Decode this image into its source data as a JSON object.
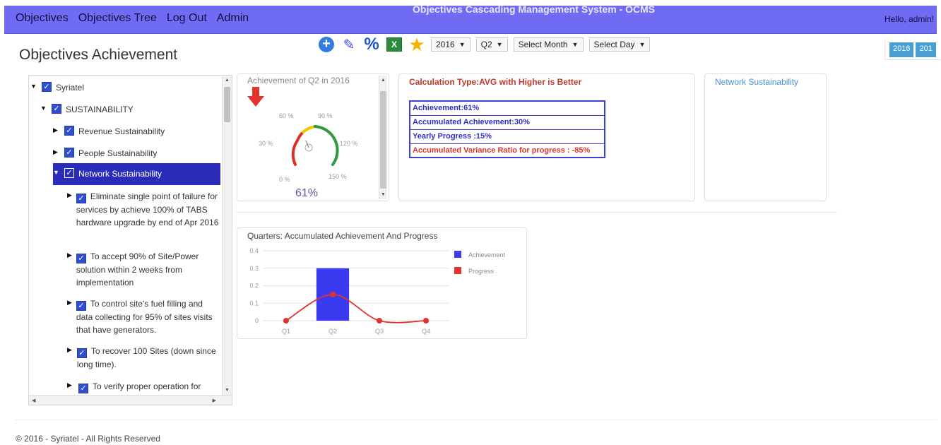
{
  "nav": {
    "links": [
      "Objectives",
      "Objectives Tree",
      "Log Out",
      "Admin"
    ],
    "system_title": "Objectives Cascading Management System - OCMS",
    "greeting": "Hello, admin!"
  },
  "page": {
    "title": "Objectives Achievement"
  },
  "toolbar": {
    "icons": [
      "add-icon",
      "edit-icon",
      "percent-icon",
      "excel-icon",
      "star-icon"
    ],
    "excel_glyph": "X",
    "year": "2016",
    "quarter": "Q2",
    "month_placeholder": "Select Month",
    "day_placeholder": "Select Day"
  },
  "year_buttons": [
    "2016",
    "201"
  ],
  "tree": {
    "root": "Syriatel",
    "level1": "SUSTAINABILITY",
    "level2": [
      "Revenue Sustainability",
      "People Sustainability",
      "Network Sustainability"
    ],
    "objectives": [
      "Eliminate single point of failure for services by achieve 100% of TABS hardware upgrade by end of Apr 2016",
      "To accept 90% of Site/Power solution within 2 weeks from implementation",
      "To control site's fuel filling and data collecting for 95% of sites visits that have generators.",
      "To recover 100 Sites (down since long time).",
      "To verify proper operation for"
    ]
  },
  "gauge": {
    "title": "Achievement of Q2 in 2016",
    "value_text": "61%",
    "value": 61,
    "max": 150,
    "ticks": [
      "0 %",
      "30 %",
      "60 %",
      "90 %",
      "120 %",
      "150 %"
    ],
    "trend": "down",
    "colors": {
      "red": "#d93025",
      "yellow": "#f2c500",
      "green": "#2e9a3a",
      "arrow": "#e0342c"
    }
  },
  "calculation": {
    "title": "Calculation Type:AVG with Higher is Better",
    "rows": [
      {
        "text": "Achievement:61%",
        "color": "blue"
      },
      {
        "text": "Accumulated Achievement:30%",
        "color": "blue"
      },
      {
        "text": "Yearly Progress :15%",
        "color": "blue"
      },
      {
        "text": "Accumulated Variance Ratio for progress : -85%",
        "color": "red"
      }
    ]
  },
  "objective_card": {
    "title": "Network Sustainability"
  },
  "chart_data": {
    "type": "bar",
    "title": "Quarters: Accumulated Achievement And Progress",
    "categories": [
      "Q1",
      "Q2",
      "Q3",
      "Q4"
    ],
    "series": [
      {
        "name": "Achievement",
        "type": "bar",
        "color": "#3a3af0",
        "values": [
          0,
          0.3,
          0,
          0
        ]
      },
      {
        "name": "Progress",
        "type": "line",
        "color": "#e0342c",
        "values": [
          0,
          0.15,
          0,
          0
        ]
      }
    ],
    "ylim": [
      0,
      0.4
    ],
    "yticks": [
      "0",
      "0.1",
      "0.2",
      "0.3",
      "0.4"
    ],
    "grid": true,
    "legend": "right"
  },
  "footer": {
    "text": "© 2016 - Syriatel - All Rights Reserved"
  }
}
